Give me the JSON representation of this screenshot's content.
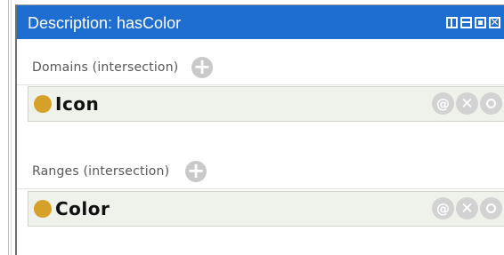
{
  "window": {
    "title": "Description: hasColor",
    "close_glyph": "✕"
  },
  "sections": [
    {
      "label": "Domains (intersection)",
      "entity": "Icon",
      "dot_color": "#d6a12a"
    },
    {
      "label": "Ranges (intersection)",
      "entity": "Color",
      "dot_color": "#d6a12a"
    }
  ],
  "row_buttons": {
    "annotate_glyph": "@",
    "delete_glyph": "✕"
  },
  "add_glyph": "+",
  "colors": {
    "title_bar": "#1e6ed2",
    "row_bg": "#eef2eb",
    "button_gray": "#d2d2d2",
    "dot": "#d6a12a"
  }
}
